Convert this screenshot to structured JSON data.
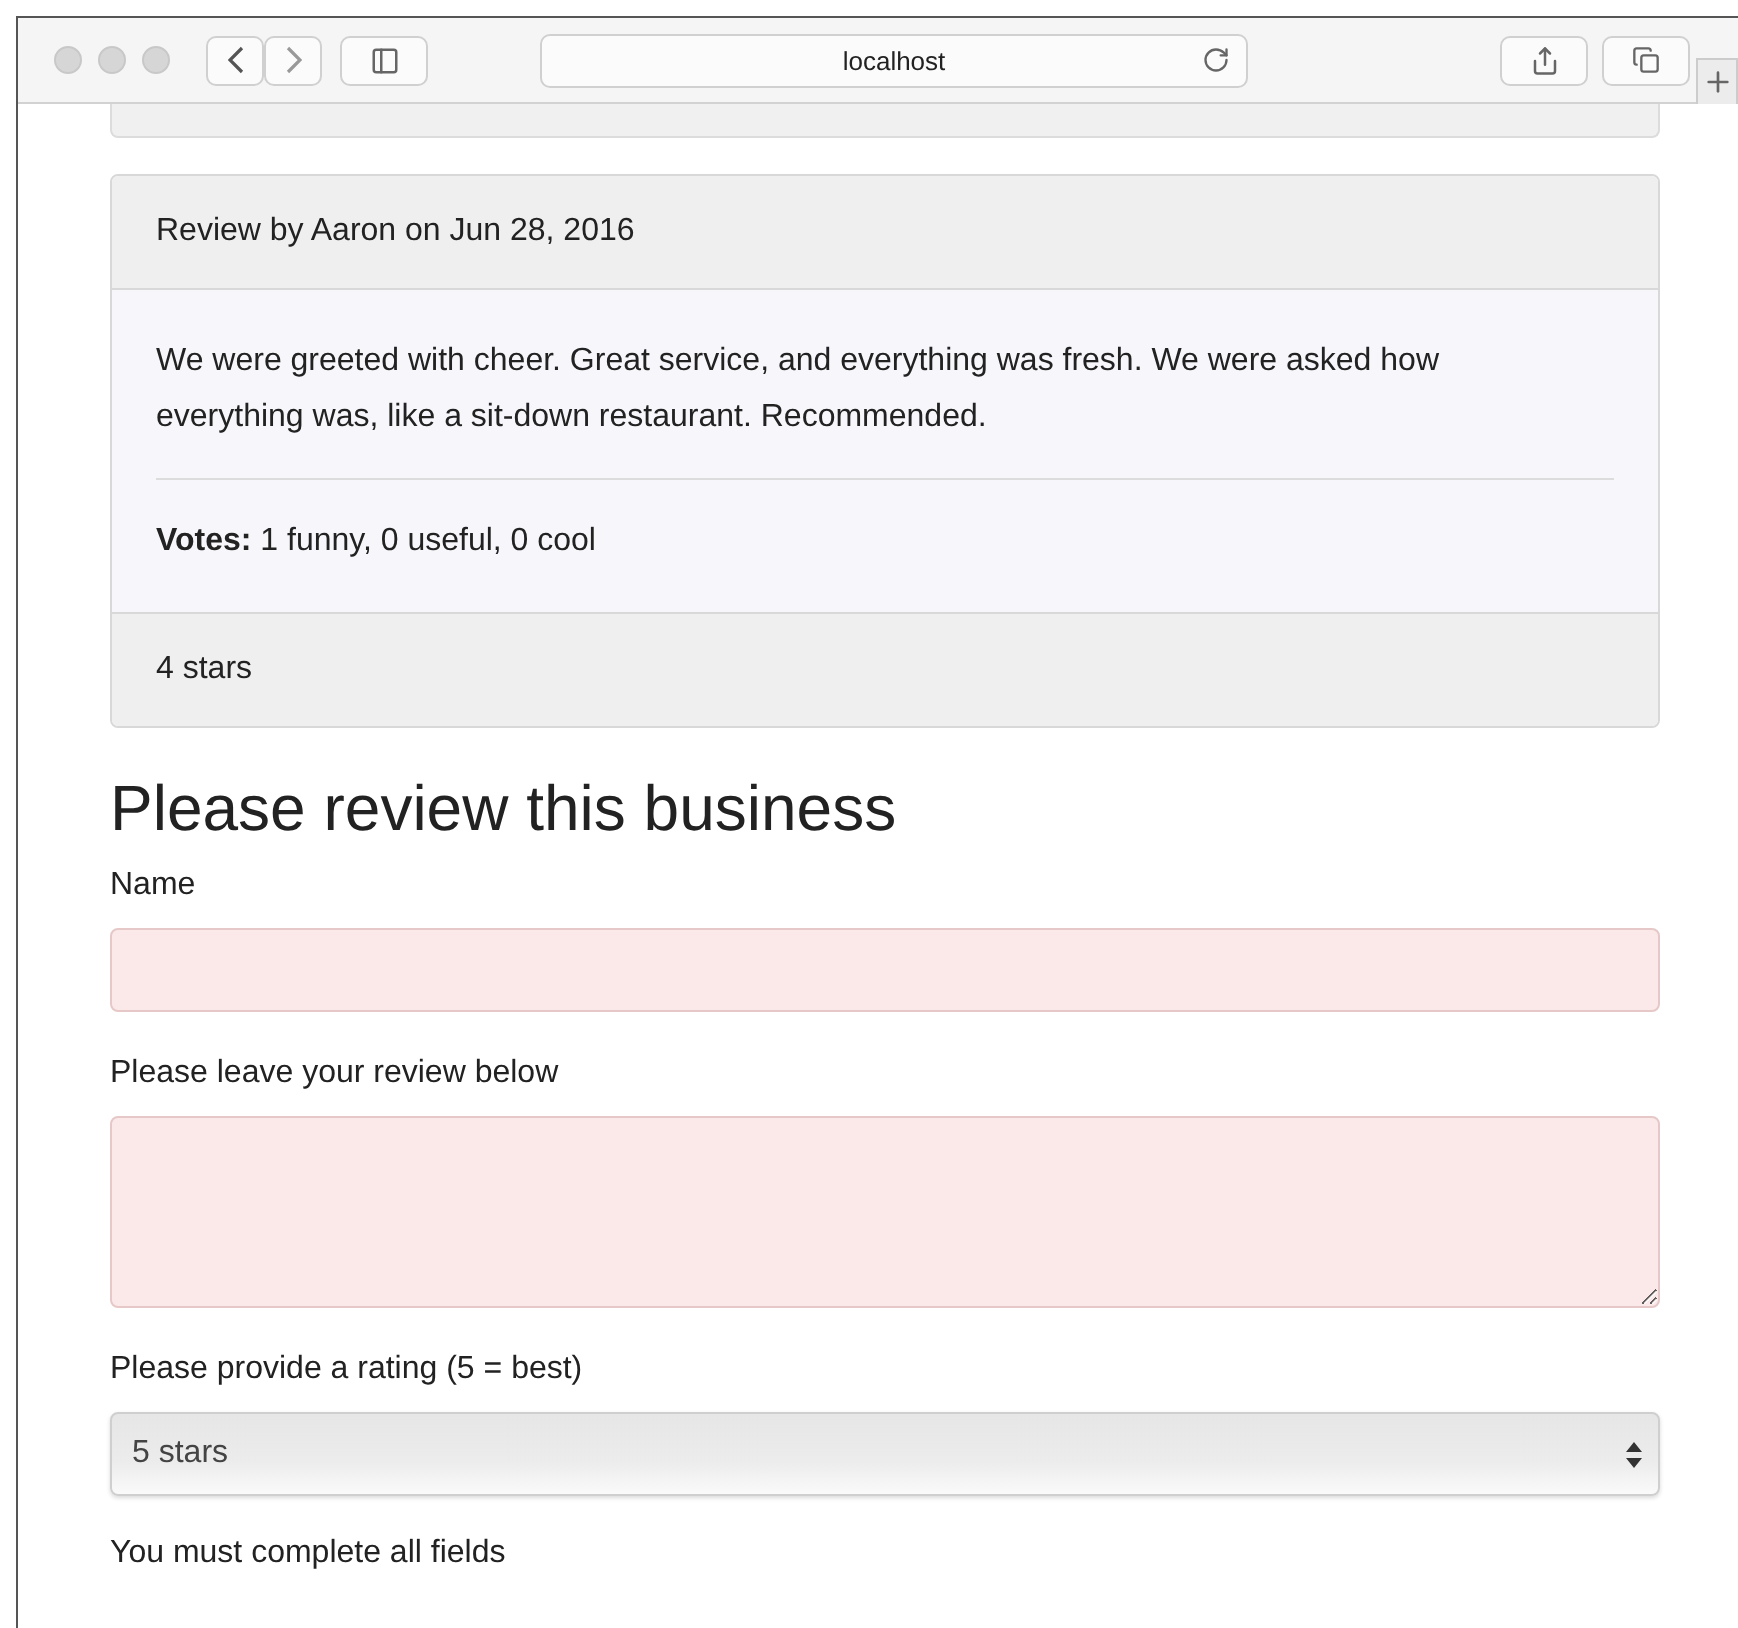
{
  "browser": {
    "address": "localhost"
  },
  "reviews": [
    {
      "header": "Review by Aaron on Jun 28, 2016",
      "text": "We were greeted with cheer. Great service, and everything was fresh. We were asked how everything was, like a sit-down restaurant. Recommended.",
      "votes": "**Votes:** 1 funny, 0 useful, 0 cool",
      "footer": "4 stars"
    }
  ],
  "form": {
    "title": "Please review this business",
    "fields": [
      {
        "kind": "input",
        "label": "Name",
        "invalid": true
      },
      {
        "kind": "textarea",
        "label": "Please leave your review below",
        "invalid": true
      },
      {
        "kind": "select",
        "label": "Please provide a rating (5 = best)",
        "value": "5 stars"
      }
    ],
    "message": "You must complete all fields"
  }
}
